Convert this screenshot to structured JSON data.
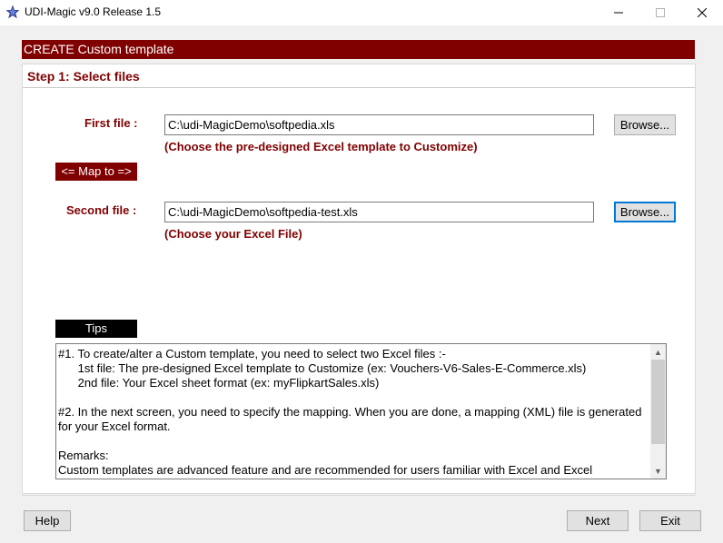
{
  "window": {
    "title": "UDI-Magic v9.0 Release 1.5",
    "icon": "star-app-icon",
    "controls": {
      "minimize": "minimize-icon",
      "maximize": "maximize-icon",
      "close": "close-icon"
    }
  },
  "header": {
    "title": "CREATE Custom template"
  },
  "step": {
    "title": "Step 1: Select files"
  },
  "first_file": {
    "label": "First file :",
    "value": "C:\\udi-MagicDemo\\softpedia.xls",
    "browse_label": "Browse...",
    "hint": "(Choose the pre-designed Excel template to Customize)"
  },
  "map_to": {
    "label": "<= Map to =>"
  },
  "second_file": {
    "label": "Second file :",
    "value": "C:\\udi-MagicDemo\\softpedia-test.xls",
    "browse_label": "Browse...",
    "hint": "(Choose your Excel File)"
  },
  "tips": {
    "label": "Tips",
    "lines": [
      "#1. To create/alter a Custom template, you need to select two Excel files :-",
      "      1st file: The pre-designed Excel template to Customize (ex: Vouchers-V6-Sales-E-Commerce.xls)",
      "      2nd file: Your Excel sheet format (ex: myFlipkartSales.xls)",
      "",
      "#2. In the next screen, you need to specify the mapping. When you are done, a mapping (XML) file is generated",
      "for your Excel format.",
      "",
      "Remarks:",
      "Custom templates are advanced feature and are recommended for users familiar with Excel and Excel"
    ]
  },
  "footer": {
    "help_label": "Help",
    "next_label": "Next",
    "exit_label": "Exit"
  },
  "colors": {
    "accent": "#800000",
    "banner_text": "#ffffff",
    "tips_label_bg": "#000000",
    "focus": "#0078d7"
  }
}
